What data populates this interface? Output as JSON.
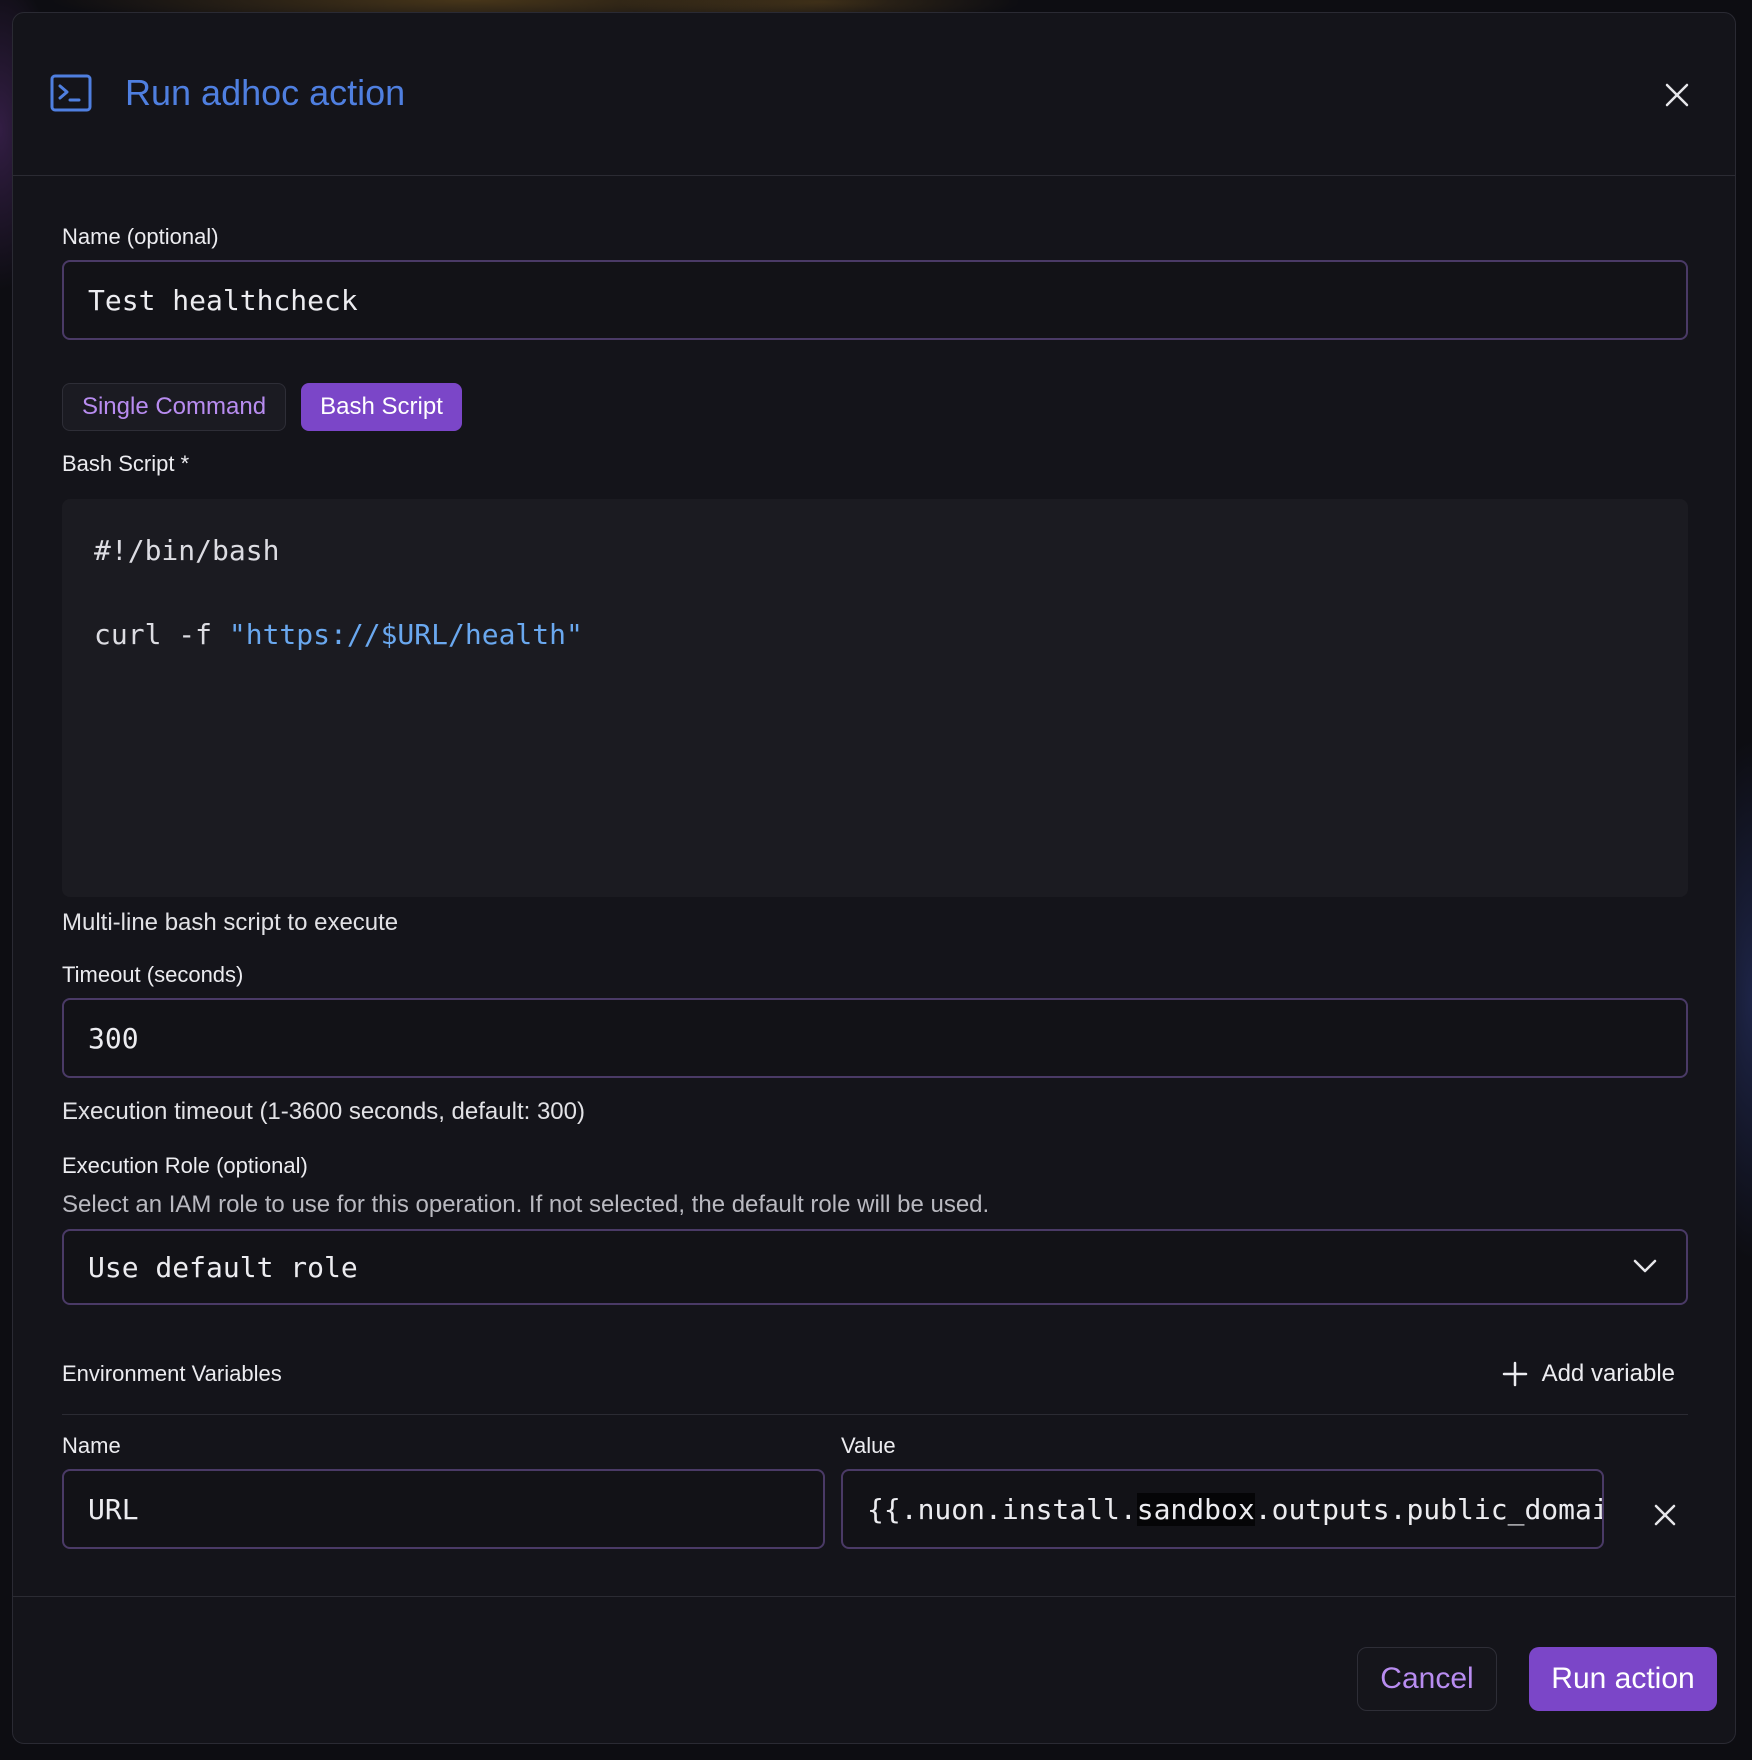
{
  "dialog": {
    "title": "Run adhoc action",
    "icon": "terminal-icon",
    "close_icon": "close-icon"
  },
  "name_field": {
    "label": "Name (optional)",
    "value": "Test healthcheck"
  },
  "mode_toggle": {
    "options": [
      "Single Command",
      "Bash Script"
    ],
    "selected": "Bash Script"
  },
  "bash_script": {
    "label": "Bash Script *",
    "lines": {
      "shebang": "#!/bin/bash",
      "command": "curl -f ",
      "command_arg": "\"https://$URL/health\""
    },
    "helper": "Multi-line bash script to execute"
  },
  "timeout_field": {
    "label": "Timeout (seconds)",
    "value": "300",
    "helper": "Execution timeout (1-3600 seconds, default: 300)"
  },
  "execution_role": {
    "label": "Execution Role (optional)",
    "description": "Select an IAM role to use for this operation. If not selected, the default role will be used.",
    "selected": "Use default role"
  },
  "env_vars": {
    "title": "Environment Variables",
    "add_label": "Add variable",
    "name_header": "Name",
    "value_header": "Value",
    "rows": [
      {
        "name": "URL",
        "value_prefix": "{{.nuon.install.",
        "value_highlight": "sandbox",
        "value_suffix": ".outputs.public_domain"
      }
    ]
  },
  "footer": {
    "cancel_label": "Cancel",
    "run_label": "Run action"
  },
  "colors": {
    "accent": "#7b46c8",
    "title": "#4f7fe0",
    "string": "#6aa8ef",
    "background": "#14141a"
  }
}
